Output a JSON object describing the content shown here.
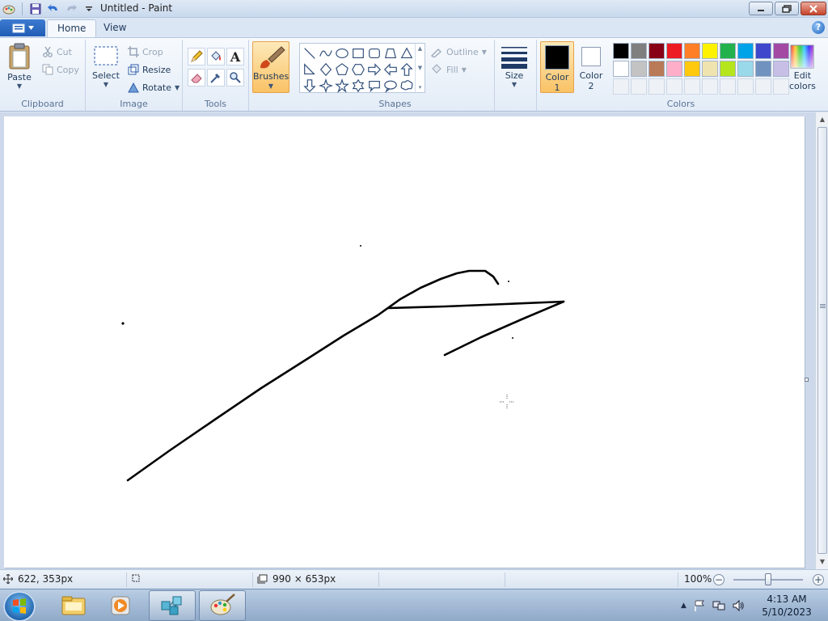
{
  "window": {
    "title": "Untitled - Paint"
  },
  "tabs": [
    {
      "label": "Home"
    },
    {
      "label": "View"
    }
  ],
  "clipboard": {
    "paste_label": "Paste",
    "cut_label": "Cut",
    "copy_label": "Copy",
    "group_label": "Clipboard"
  },
  "image": {
    "select_label": "Select",
    "crop_label": "Crop",
    "resize_label": "Resize",
    "rotate_label": "Rotate",
    "group_label": "Image"
  },
  "tools": {
    "group_label": "Tools",
    "text_tool_glyph": "A"
  },
  "brushes": {
    "label": "Brushes"
  },
  "shapes": {
    "group_label": "Shapes",
    "outline_label": "Outline",
    "fill_label": "Fill"
  },
  "size": {
    "label": "Size"
  },
  "colors": {
    "color1_line1": "Color",
    "color1_line2": "1",
    "color2_line1": "Color",
    "color2_line2": "2",
    "color1_value": "#000000",
    "color2_value": "#ffffff",
    "edit_line1": "Edit",
    "edit_line2": "colors",
    "group_label": "Colors",
    "palette_row1": [
      "#000000",
      "#7f7f7f",
      "#880015",
      "#ed1c24",
      "#ff7f27",
      "#fff200",
      "#22b14c",
      "#00a2e8",
      "#3f48cc",
      "#a349a4"
    ],
    "palette_row2": [
      "#ffffff",
      "#c3c3c3",
      "#b97a57",
      "#ffaec9",
      "#ffc90e",
      "#efe4b0",
      "#b5e61d",
      "#99d9ea",
      "#7092be",
      "#c8bfe7"
    ]
  },
  "statusbar": {
    "cursor_pos": "622, 353px",
    "canvas_size": "990 × 653px",
    "zoom": "100%"
  },
  "zoom_level": 1.0,
  "taskbar": {
    "apps": [
      "explorer-icon",
      "media-player-icon",
      "network-app-icon",
      "paint-icon"
    ]
  },
  "clock": {
    "time": "4:13 AM",
    "date": "5/10/2023"
  }
}
